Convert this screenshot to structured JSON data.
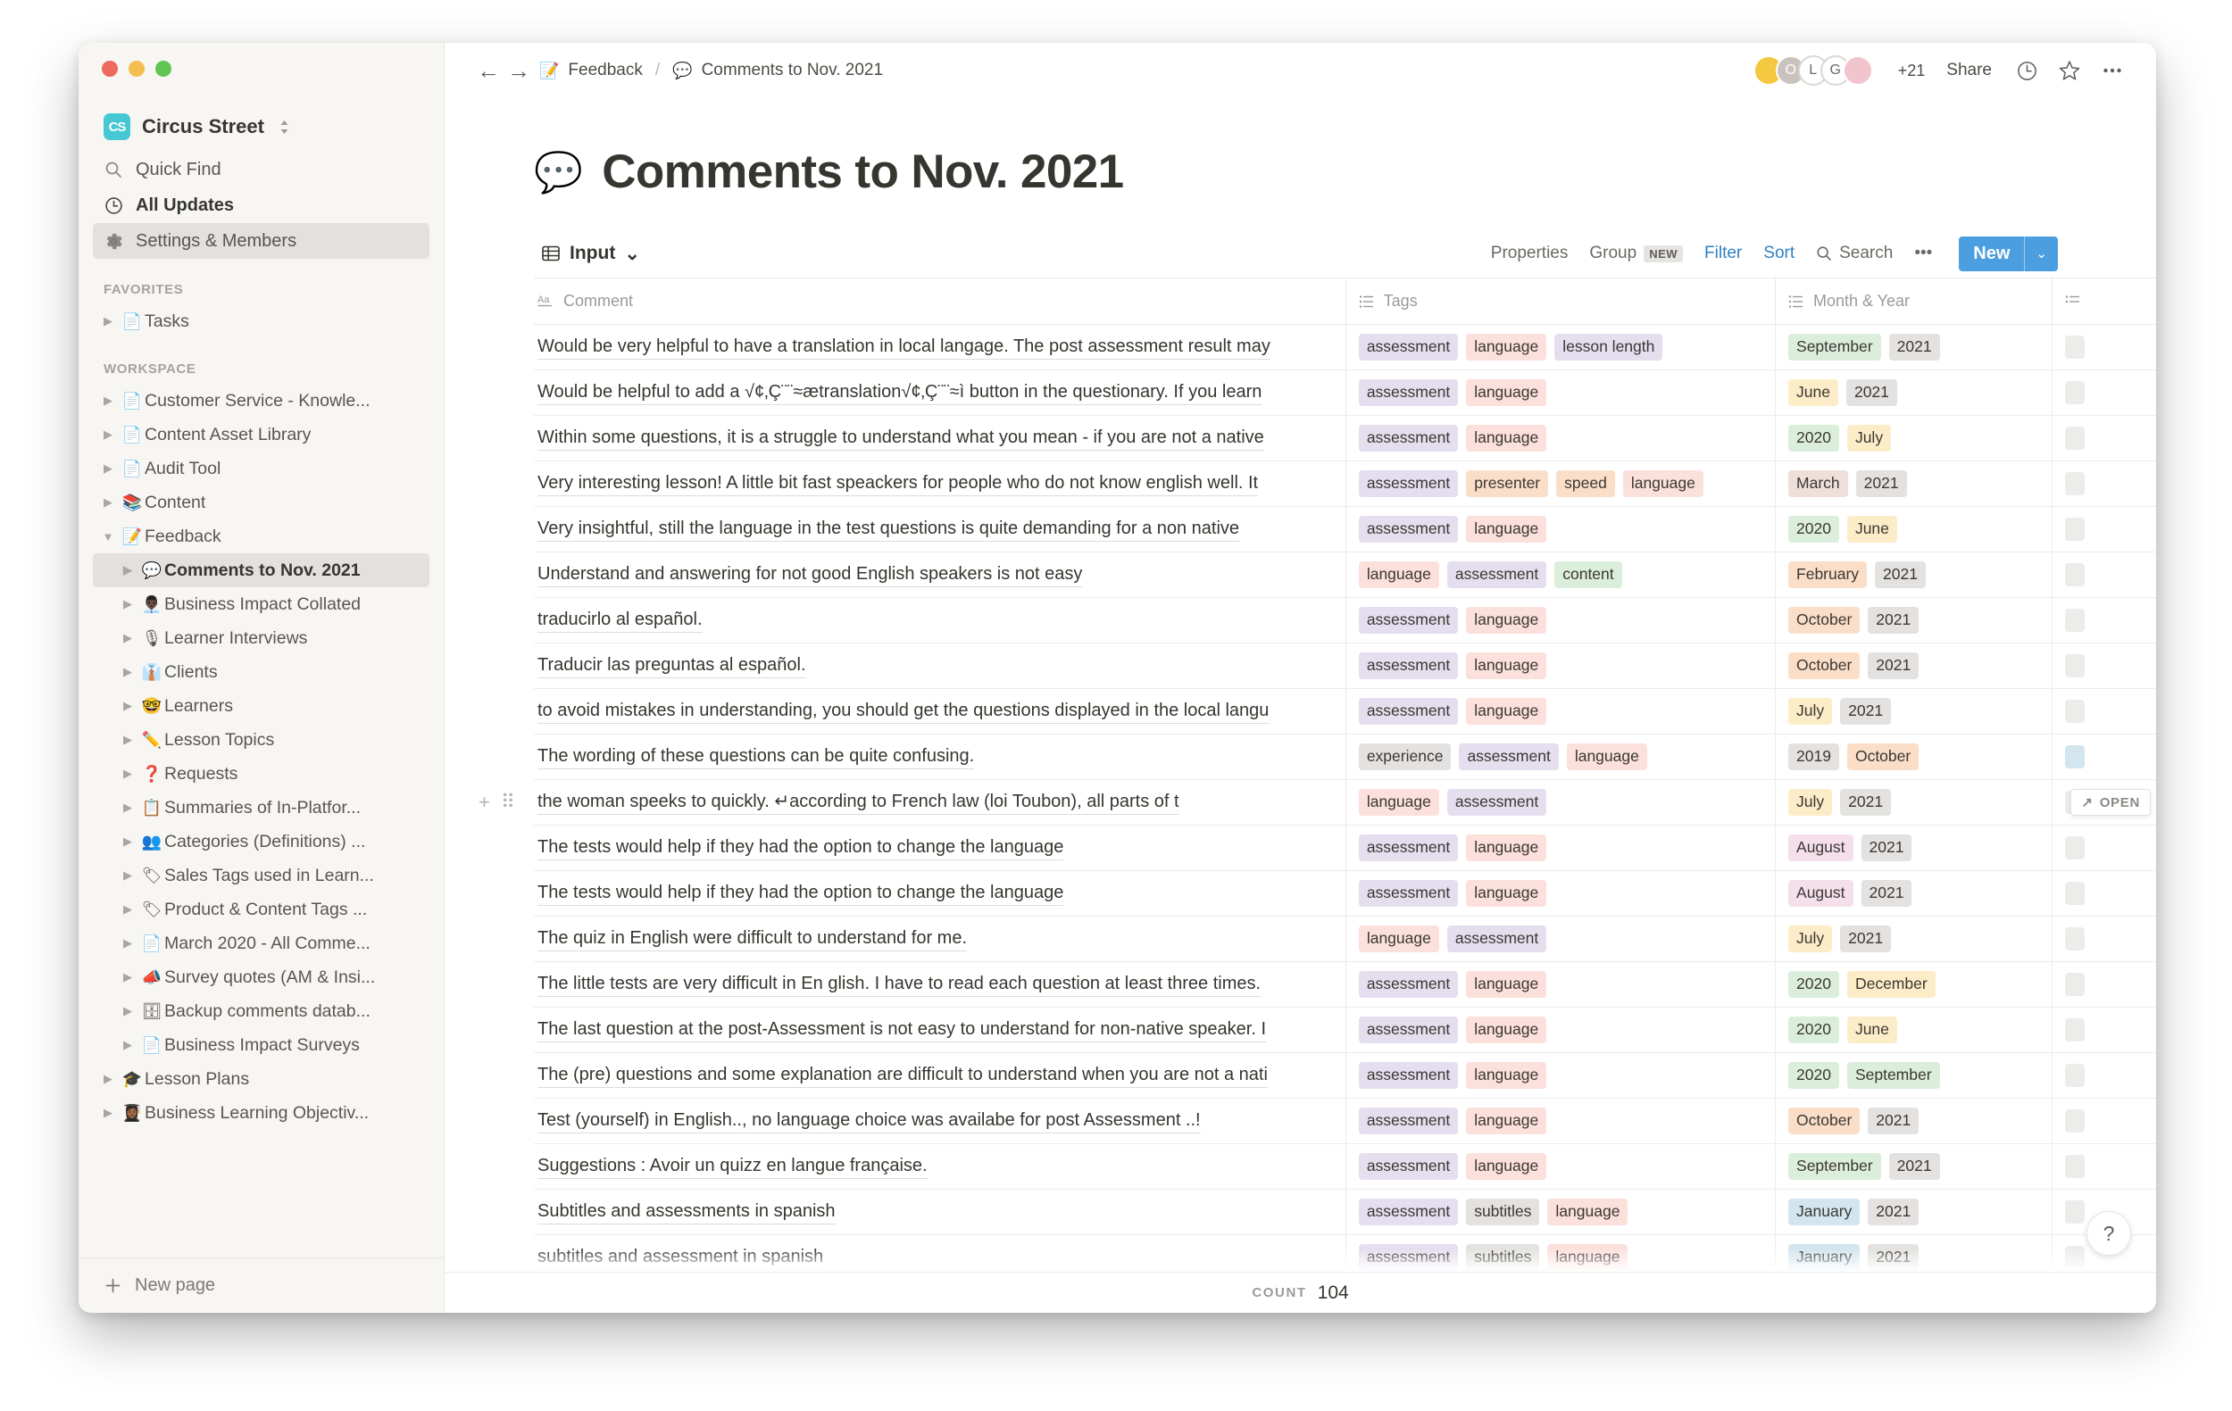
{
  "window": {
    "traffic_lights": [
      "close",
      "minimize",
      "zoom"
    ]
  },
  "sidebar": {
    "workspace": {
      "name": "Circus Street",
      "logo_text": "CS",
      "logo_color": "#45c7d4",
      "caret": "⌃⌄"
    },
    "nav": [
      {
        "label": "Quick Find",
        "icon": "search-icon",
        "active": false
      },
      {
        "label": "All Updates",
        "icon": "clock-icon",
        "active": false
      },
      {
        "label": "Settings & Members",
        "icon": "gear-icon",
        "active": true
      }
    ],
    "favorites_label": "FAVORITES",
    "favorites": [
      {
        "label": "Tasks",
        "emoji": "📄",
        "indent": 1
      }
    ],
    "workspace_label": "WORKSPACE",
    "tree": [
      {
        "label": "Customer Service - Knowle...",
        "emoji": "📄",
        "indent": 1,
        "active": false
      },
      {
        "label": "Content Asset Library",
        "emoji": "📄",
        "indent": 1,
        "active": false
      },
      {
        "label": "Audit Tool",
        "emoji": "📄",
        "indent": 1,
        "active": false
      },
      {
        "label": "Content",
        "emoji": "📚",
        "indent": 1,
        "active": false
      },
      {
        "label": "Feedback",
        "emoji": "📝",
        "indent": 1,
        "active": false,
        "expanded": true
      },
      {
        "label": "Comments to Nov. 2021",
        "emoji": "💬",
        "indent": 2,
        "active": true
      },
      {
        "label": "Business Impact Collated",
        "emoji": "👨🏿‍💼",
        "indent": 2,
        "active": false
      },
      {
        "label": "Learner Interviews",
        "emoji": "🎙",
        "indent": 2,
        "active": false
      },
      {
        "label": "Clients",
        "emoji": "👔",
        "indent": 2,
        "active": false
      },
      {
        "label": "Learners",
        "emoji": "🤓",
        "indent": 2,
        "active": false
      },
      {
        "label": "Lesson Topics",
        "emoji": "✏️",
        "indent": 2,
        "active": false
      },
      {
        "label": "Requests",
        "emoji": "❓",
        "indent": 2,
        "active": false
      },
      {
        "label": "Summaries of In-Platfor...",
        "emoji": "📋",
        "indent": 2,
        "active": false
      },
      {
        "label": "Categories (Definitions) ...",
        "emoji": "👥",
        "indent": 2,
        "active": false
      },
      {
        "label": "Sales Tags used in Learn...",
        "emoji": "🏷",
        "indent": 2,
        "active": false
      },
      {
        "label": "Product & Content Tags ...",
        "emoji": "🏷",
        "indent": 2,
        "active": false
      },
      {
        "label": "March 2020 - All Comme...",
        "emoji": "📄",
        "indent": 2,
        "active": false
      },
      {
        "label": "Survey quotes (AM & Insi...",
        "emoji": "📣",
        "indent": 2,
        "active": false
      },
      {
        "label": "Backup comments datab...",
        "emoji": "🗄",
        "indent": 2,
        "active": false
      },
      {
        "label": "Business Impact Surveys",
        "emoji": "📄",
        "indent": 2,
        "active": false
      },
      {
        "label": "Lesson Plans",
        "emoji": "🎓",
        "indent": 1,
        "active": false
      },
      {
        "label": "Business Learning Objectiv...",
        "emoji": "👩🏾‍🎓",
        "indent": 1,
        "active": false
      }
    ],
    "new_page": {
      "label": "New page",
      "icon": "plus-icon"
    }
  },
  "topbar": {
    "back_icon": "arrow-left-icon",
    "forward_icon": "arrow-right-icon",
    "breadcrumb": [
      {
        "emoji": "📝",
        "label": "Feedback"
      },
      {
        "emoji": "💬",
        "label": "Comments to Nov. 2021"
      }
    ],
    "separator": "/",
    "avatars": [
      {
        "initial": "",
        "color": "#f5c842"
      },
      {
        "initial": "O",
        "color": "#c9c2bd"
      },
      {
        "initial": "L",
        "color": "#ffffff"
      },
      {
        "initial": "G",
        "color": "#ffffff"
      },
      {
        "initial": "",
        "color": "#f2c4cd"
      }
    ],
    "avatar_overflow": "+21",
    "share_label": "Share",
    "icons": [
      "clock-icon",
      "star-icon",
      "more-horizontal-icon"
    ]
  },
  "page": {
    "emoji": "💬",
    "title": "Comments to Nov. 2021"
  },
  "db_toolbar": {
    "view_name": "Input",
    "view_icon": "table-icon",
    "view_caret": "⌄",
    "tools": [
      {
        "label": "Properties",
        "style": "gray"
      },
      {
        "label": "Group",
        "style": "gray",
        "badge": "NEW"
      },
      {
        "label": "Filter",
        "style": "blue"
      },
      {
        "label": "Sort",
        "style": "blue"
      },
      {
        "label": "Search",
        "style": "gray",
        "icon": "search-icon"
      },
      {
        "label": "•••",
        "style": "gray"
      }
    ],
    "new_button": {
      "label": "New",
      "caret": "⌄",
      "color": "#4b9fe1"
    }
  },
  "table": {
    "columns": [
      {
        "label": "Comment",
        "icon": "title-text-icon"
      },
      {
        "label": "Tags",
        "icon": "multiselect-icon"
      },
      {
        "label": "Month & Year",
        "icon": "multiselect-icon"
      },
      {
        "label": "",
        "icon": "multiselect-icon"
      }
    ],
    "open_chip": {
      "label": "OPEN",
      "icon": "expand-icon",
      "row_index": 10
    },
    "row_handles": {
      "add_icon": "plus-icon",
      "drag_icon": "drag-handle-icon",
      "row_index": 10
    },
    "rows": [
      {
        "comment": "Would be very helpful to have a translation in local langage. The post assessment result may",
        "tags": [
          {
            "t": "assessment",
            "c": "purple"
          },
          {
            "t": "language",
            "c": "red"
          },
          {
            "t": "lesson length",
            "c": "purple"
          }
        ],
        "month": [
          {
            "t": "September",
            "c": "green"
          },
          {
            "t": "2021",
            "c": "gray"
          }
        ],
        "extra": "gray"
      },
      {
        "comment": "Would be helpful to add a √¢‚Ç¨¨≈ætranslation√¢‚Ç¨¨≈ì button in the questionary. If you learn",
        "tags": [
          {
            "t": "assessment",
            "c": "purple"
          },
          {
            "t": "language",
            "c": "red"
          }
        ],
        "month": [
          {
            "t": "June",
            "c": "yellow"
          },
          {
            "t": "2021",
            "c": "gray"
          }
        ],
        "extra": "gray"
      },
      {
        "comment": "Within some questions, it is a struggle to understand what you mean - if you are not a native",
        "tags": [
          {
            "t": "assessment",
            "c": "purple"
          },
          {
            "t": "language",
            "c": "red"
          }
        ],
        "month": [
          {
            "t": "2020",
            "c": "green"
          },
          {
            "t": "July",
            "c": "yellow"
          }
        ],
        "extra": "gray"
      },
      {
        "comment": "Very interesting lesson! A little bit fast speackers for people who do not know english well. It",
        "tags": [
          {
            "t": "assessment",
            "c": "purple"
          },
          {
            "t": "presenter",
            "c": "orange"
          },
          {
            "t": "speed",
            "c": "orange"
          },
          {
            "t": "language",
            "c": "red"
          }
        ],
        "month": [
          {
            "t": "March",
            "c": "pinkbrown"
          },
          {
            "t": "2021",
            "c": "gray"
          }
        ],
        "extra": "gray"
      },
      {
        "comment": "Very insightful, still the language in the test questions is quite demanding for a non native",
        "tags": [
          {
            "t": "assessment",
            "c": "purple"
          },
          {
            "t": "language",
            "c": "red"
          }
        ],
        "month": [
          {
            "t": "2020",
            "c": "green"
          },
          {
            "t": "June",
            "c": "yellow"
          }
        ],
        "extra": "gray"
      },
      {
        "comment": "Understand and answering for not good English speakers is not easy",
        "tags": [
          {
            "t": "language",
            "c": "red"
          },
          {
            "t": "assessment",
            "c": "purple"
          },
          {
            "t": "content",
            "c": "green"
          }
        ],
        "month": [
          {
            "t": "February",
            "c": "orange"
          },
          {
            "t": "2021",
            "c": "gray"
          }
        ],
        "extra": "gray"
      },
      {
        "comment": "traducirlo al español.",
        "tags": [
          {
            "t": "assessment",
            "c": "purple"
          },
          {
            "t": "language",
            "c": "red"
          }
        ],
        "month": [
          {
            "t": "October",
            "c": "orange"
          },
          {
            "t": "2021",
            "c": "gray"
          }
        ],
        "extra": "gray"
      },
      {
        "comment": "Traducir las preguntas al español.",
        "tags": [
          {
            "t": "assessment",
            "c": "purple"
          },
          {
            "t": "language",
            "c": "red"
          }
        ],
        "month": [
          {
            "t": "October",
            "c": "orange"
          },
          {
            "t": "2021",
            "c": "gray"
          }
        ],
        "extra": "gray"
      },
      {
        "comment": "to avoid mistakes in understanding, you should get the questions displayed in the local langu",
        "tags": [
          {
            "t": "assessment",
            "c": "purple"
          },
          {
            "t": "language",
            "c": "red"
          }
        ],
        "month": [
          {
            "t": "July",
            "c": "yellow"
          },
          {
            "t": "2021",
            "c": "gray"
          }
        ],
        "extra": "gray"
      },
      {
        "comment": "The wording of these questions can be quite confusing.",
        "tags": [
          {
            "t": "experience",
            "c": "gray"
          },
          {
            "t": "assessment",
            "c": "purple"
          },
          {
            "t": "language",
            "c": "red"
          }
        ],
        "month": [
          {
            "t": "2019",
            "c": "gray"
          },
          {
            "t": "October",
            "c": "orange"
          }
        ],
        "extra": "blue"
      },
      {
        "comment": "the woman speeks to quickly. ↵according to French law (loi Toubon), all parts of t",
        "tags": [
          {
            "t": "language",
            "c": "red"
          },
          {
            "t": "assessment",
            "c": "purple"
          }
        ],
        "month": [
          {
            "t": "July",
            "c": "yellow"
          },
          {
            "t": "2021",
            "c": "gray"
          }
        ],
        "extra": "gray"
      },
      {
        "comment": "The tests would help if they had the option to change the language",
        "tags": [
          {
            "t": "assessment",
            "c": "purple"
          },
          {
            "t": "language",
            "c": "red"
          }
        ],
        "month": [
          {
            "t": "August",
            "c": "pink"
          },
          {
            "t": "2021",
            "c": "gray"
          }
        ],
        "extra": "gray"
      },
      {
        "comment": "The tests would help if they had the option to change the language",
        "tags": [
          {
            "t": "assessment",
            "c": "purple"
          },
          {
            "t": "language",
            "c": "red"
          }
        ],
        "month": [
          {
            "t": "August",
            "c": "pink"
          },
          {
            "t": "2021",
            "c": "gray"
          }
        ],
        "extra": "gray"
      },
      {
        "comment": "The quiz in English were difficult to understand for me.",
        "tags": [
          {
            "t": "language",
            "c": "red"
          },
          {
            "t": "assessment",
            "c": "purple"
          }
        ],
        "month": [
          {
            "t": "July",
            "c": "yellow"
          },
          {
            "t": "2021",
            "c": "gray"
          }
        ],
        "extra": "gray"
      },
      {
        "comment": "The little tests are very difficult in En glish. I have to read each question at least three times.",
        "tags": [
          {
            "t": "assessment",
            "c": "purple"
          },
          {
            "t": "language",
            "c": "red"
          }
        ],
        "month": [
          {
            "t": "2020",
            "c": "green"
          },
          {
            "t": "December",
            "c": "yellow"
          }
        ],
        "extra": "gray"
      },
      {
        "comment": "The last question at the post-Assessment is not easy to understand for non-native speaker. I",
        "tags": [
          {
            "t": "assessment",
            "c": "purple"
          },
          {
            "t": "language",
            "c": "red"
          }
        ],
        "month": [
          {
            "t": "2020",
            "c": "green"
          },
          {
            "t": "June",
            "c": "yellow"
          }
        ],
        "extra": "gray"
      },
      {
        "comment": "The (pre) questions and some explanation are difficult to understand when you are not a nati",
        "tags": [
          {
            "t": "assessment",
            "c": "purple"
          },
          {
            "t": "language",
            "c": "red"
          }
        ],
        "month": [
          {
            "t": "2020",
            "c": "green"
          },
          {
            "t": "September",
            "c": "green"
          }
        ],
        "extra": "gray"
      },
      {
        "comment": "Test (yourself) in English.., no language choice was availabe for post Assessment ..!",
        "tags": [
          {
            "t": "assessment",
            "c": "purple"
          },
          {
            "t": "language",
            "c": "red"
          }
        ],
        "month": [
          {
            "t": "October",
            "c": "orange"
          },
          {
            "t": "2021",
            "c": "gray"
          }
        ],
        "extra": "gray"
      },
      {
        "comment": "Suggestions : Avoir un quizz en langue française.",
        "tags": [
          {
            "t": "assessment",
            "c": "purple"
          },
          {
            "t": "language",
            "c": "red"
          }
        ],
        "month": [
          {
            "t": "September",
            "c": "green"
          },
          {
            "t": "2021",
            "c": "gray"
          }
        ],
        "extra": "gray"
      },
      {
        "comment": "Subtitles and assessments in spanish",
        "tags": [
          {
            "t": "assessment",
            "c": "purple"
          },
          {
            "t": "subtitles",
            "c": "gray"
          },
          {
            "t": "language",
            "c": "red"
          }
        ],
        "month": [
          {
            "t": "January",
            "c": "blue"
          },
          {
            "t": "2021",
            "c": "gray"
          }
        ],
        "extra": "gray"
      },
      {
        "comment": "subtitles and assessment in spanish",
        "tags": [
          {
            "t": "assessment",
            "c": "purple"
          },
          {
            "t": "subtitles",
            "c": "gray"
          },
          {
            "t": "language",
            "c": "red"
          }
        ],
        "month": [
          {
            "t": "January",
            "c": "blue"
          },
          {
            "t": "2021",
            "c": "gray"
          }
        ],
        "extra": "gray"
      }
    ]
  },
  "footer": {
    "count_label": "COUNT",
    "count_value": "104"
  },
  "help_button": {
    "label": "?"
  },
  "colors": {
    "purple": "#e5deee",
    "red": "#fbe0dc",
    "orange": "#fadec8",
    "yellow": "#fdecc8",
    "green": "#dbeddb",
    "blue": "#d3e5ef",
    "pink": "#f4dfeb",
    "pinkbrown": "#eedfda",
    "gray": "#e3e2e0",
    "accent": "#4b9fe1",
    "sidebar_bg": "#f7f6f3",
    "text": "#37352f"
  }
}
